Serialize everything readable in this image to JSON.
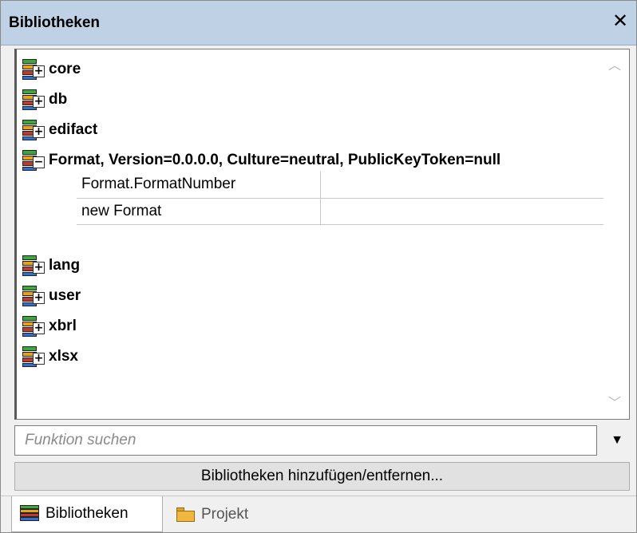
{
  "window": {
    "title": "Bibliotheken",
    "close_glyph": "✕"
  },
  "tree": {
    "nodes": [
      {
        "label": "core",
        "icon": "library-icon",
        "expander": "+"
      },
      {
        "label": "db",
        "icon": "library-icon",
        "expander": "+"
      },
      {
        "label": "edifact",
        "icon": "library-icon",
        "expander": "+"
      },
      {
        "label": "Format, Version=0.0.0.0, Culture=neutral, PublicKeyToken=null",
        "icon": "library-icon",
        "expander": "−"
      },
      {
        "label": "lang",
        "icon": "library-icon",
        "expander": "+"
      },
      {
        "label": "user",
        "icon": "library-icon",
        "expander": "+"
      },
      {
        "label": "xbrl",
        "icon": "library-icon",
        "expander": "+"
      },
      {
        "label": "xlsx",
        "icon": "library-icon",
        "expander": "+"
      }
    ],
    "format_functions": [
      {
        "name": "Format.FormatNumber",
        "detail": ""
      },
      {
        "name": "new Format",
        "detail": ""
      }
    ],
    "scroll_up_glyph": "︿",
    "scroll_down_glyph": "﹀"
  },
  "search": {
    "placeholder": "Funktion suchen",
    "dropdown_glyph": "▼"
  },
  "add_remove_button": "Bibliotheken hinzufügen/entfernen...",
  "tabs": [
    {
      "label": "Bibliotheken",
      "icon": "library-stack-icon",
      "active": true
    },
    {
      "label": "Projekt",
      "icon": "folder-icon",
      "active": false
    }
  ],
  "colors": {
    "titlebar": "#bfd1e5",
    "book_green": "#3aa83a",
    "book_orange": "#e8a11a",
    "book_red": "#c0392b",
    "book_blue": "#2e6fd1",
    "folder": "#f0b73e"
  }
}
